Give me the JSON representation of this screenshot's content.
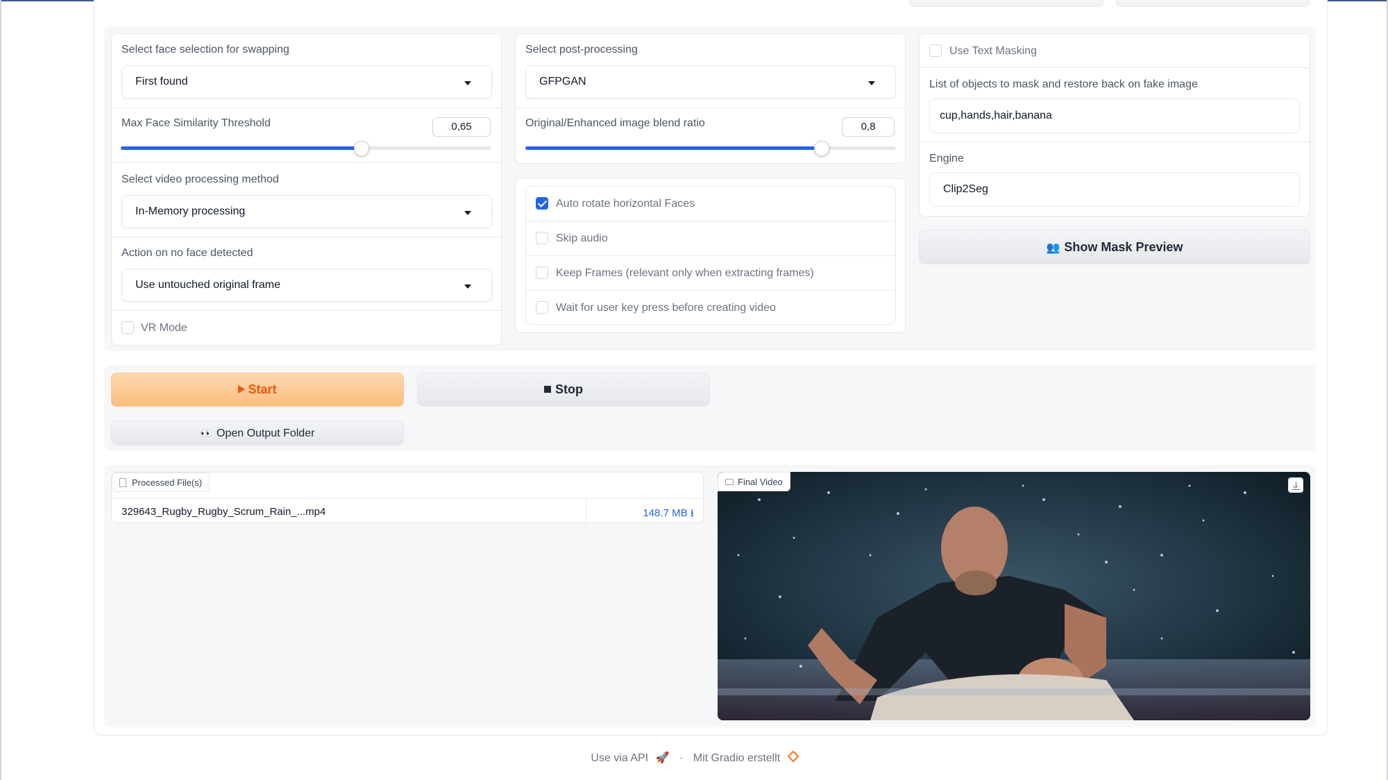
{
  "face_panel": {
    "face_selection_label": "Select face selection for swapping",
    "face_selection_value": "First found",
    "similarity_label": "Max Face Similarity Threshold",
    "similarity_value": "0,65",
    "similarity_level": 0.65,
    "video_method_label": "Select video processing method",
    "video_method_value": "In-Memory processing",
    "no_face_label": "Action on no face detected",
    "no_face_value": "Use untouched original frame",
    "vr_mode_label": "VR Mode",
    "vr_mode_checked": false
  },
  "post_panel": {
    "post_processing_label": "Select post-processing",
    "post_processing_value": "GFPGAN",
    "blend_label": "Original/Enhanced image blend ratio",
    "blend_value": "0,8",
    "blend_level": 0.8
  },
  "options_panel": {
    "auto_rotate_label": "Auto rotate horizontal Faces",
    "auto_rotate_checked": true,
    "skip_audio_label": "Skip audio",
    "keep_frames_label": "Keep Frames (relevant only when extracting frames)",
    "wait_key_label": "Wait for user key press before creating video"
  },
  "mask_panel": {
    "use_text_masking_label": "Use Text Masking",
    "objects_label": "List of objects to mask and restore back on fake image",
    "objects_value": "cup,hands,hair,banana",
    "engine_label": "Engine",
    "engine_value": "Clip2Seg",
    "show_mask_icon": "👥",
    "show_mask_label": "Show Mask Preview"
  },
  "actions": {
    "start_label": "Start",
    "stop_label": "Stop",
    "open_folder_icon": "👀",
    "open_folder_label": "Open Output Folder"
  },
  "output": {
    "files_tag": "Processed File(s)",
    "file_name": "329643_Rugby_Rugby_Scrum_Rain_...mp4",
    "file_size": "148.7 MB ⭳",
    "video_tag": "Final Video"
  },
  "footer": {
    "api_text": "Use via API",
    "api_icon": "🚀",
    "separator": "·",
    "built_text": "Mit Gradio erstellt",
    "gradio_icon": "gradio-logo"
  },
  "colors": {
    "accent": "#2563eb",
    "primary_button": "#fbbd7f",
    "primary_text": "#ea580c"
  }
}
